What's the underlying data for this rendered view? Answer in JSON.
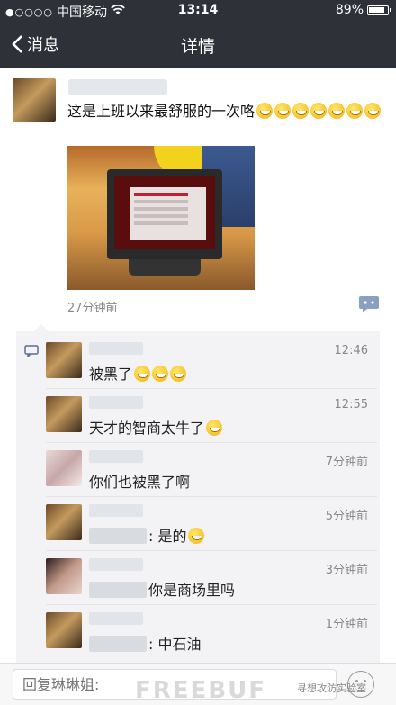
{
  "status": {
    "carrier": "中国移动",
    "time": "13:14",
    "battery": "89%"
  },
  "nav": {
    "back_label": "消息",
    "title": "详情"
  },
  "post": {
    "text": "这是上班以来最舒服的一次咯",
    "emoji_count": 7,
    "time": "27分钟前"
  },
  "comments": [
    {
      "text": "被黑了",
      "emoji": 3,
      "time": "12:46",
      "avatar": "brown",
      "prefix_blur": false
    },
    {
      "text": "天才的智商太牛了",
      "emoji": 1,
      "time": "12:55",
      "avatar": "brown",
      "prefix_blur": false
    },
    {
      "text": "你们也被黑了啊",
      "emoji": 0,
      "time": "7分钟前",
      "avatar": "pink",
      "prefix_blur": false
    },
    {
      "text": ": 是的",
      "emoji": 1,
      "time": "5分钟前",
      "avatar": "brown",
      "prefix_blur": true
    },
    {
      "text": "你是商场里吗",
      "emoji": 0,
      "time": "3分钟前",
      "avatar": "dark",
      "prefix_blur": true
    },
    {
      "text": ": 中石油",
      "emoji": 0,
      "time": "1分钟前",
      "avatar": "brown",
      "prefix_blur": true
    }
  ],
  "reply": {
    "placeholder": "回复琳琳姐:"
  },
  "watermark": {
    "main": "FREEBUF",
    "sub": "寻想攻防实验室"
  },
  "colors": {
    "nav_bg": "#2e3238",
    "comments_bg": "#f3f3f5"
  }
}
